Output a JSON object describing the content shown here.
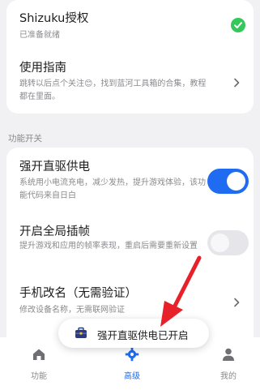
{
  "shizuku": {
    "title": "Shizuku授权",
    "subtitle": "已准备就绪"
  },
  "guide": {
    "title": "使用指南",
    "subtitle": "跳转以后点个关注😊，找到蓝河工具箱的合集，教程都在里面。"
  },
  "section": {
    "label": "功能开关"
  },
  "items": [
    {
      "title": "强开直驱供电",
      "subtitle": "系统用小电流充电，减少发热，提升游戏体验，该功能代码来自日白",
      "toggle": true
    },
    {
      "title": "开启全局插帧",
      "subtitle": "提升游戏和应用的帧率表现，重启后需要重新设置",
      "toggle": false
    },
    {
      "title": "手机改名（无需验证）",
      "subtitle": "修改设备名称，无需联网验证"
    }
  ],
  "nav": {
    "tabs": [
      {
        "label": "功能",
        "icon": "home-icon",
        "active": false
      },
      {
        "label": "高级",
        "icon": "gear-icon",
        "active": true
      },
      {
        "label": "我的",
        "icon": "person-icon",
        "active": false
      }
    ]
  },
  "toast": {
    "text": "强开直驱供电已开启"
  },
  "colors": {
    "accent": "#1f6cf2",
    "success": "#34c759",
    "annotation_arrow": "#e8202a"
  }
}
